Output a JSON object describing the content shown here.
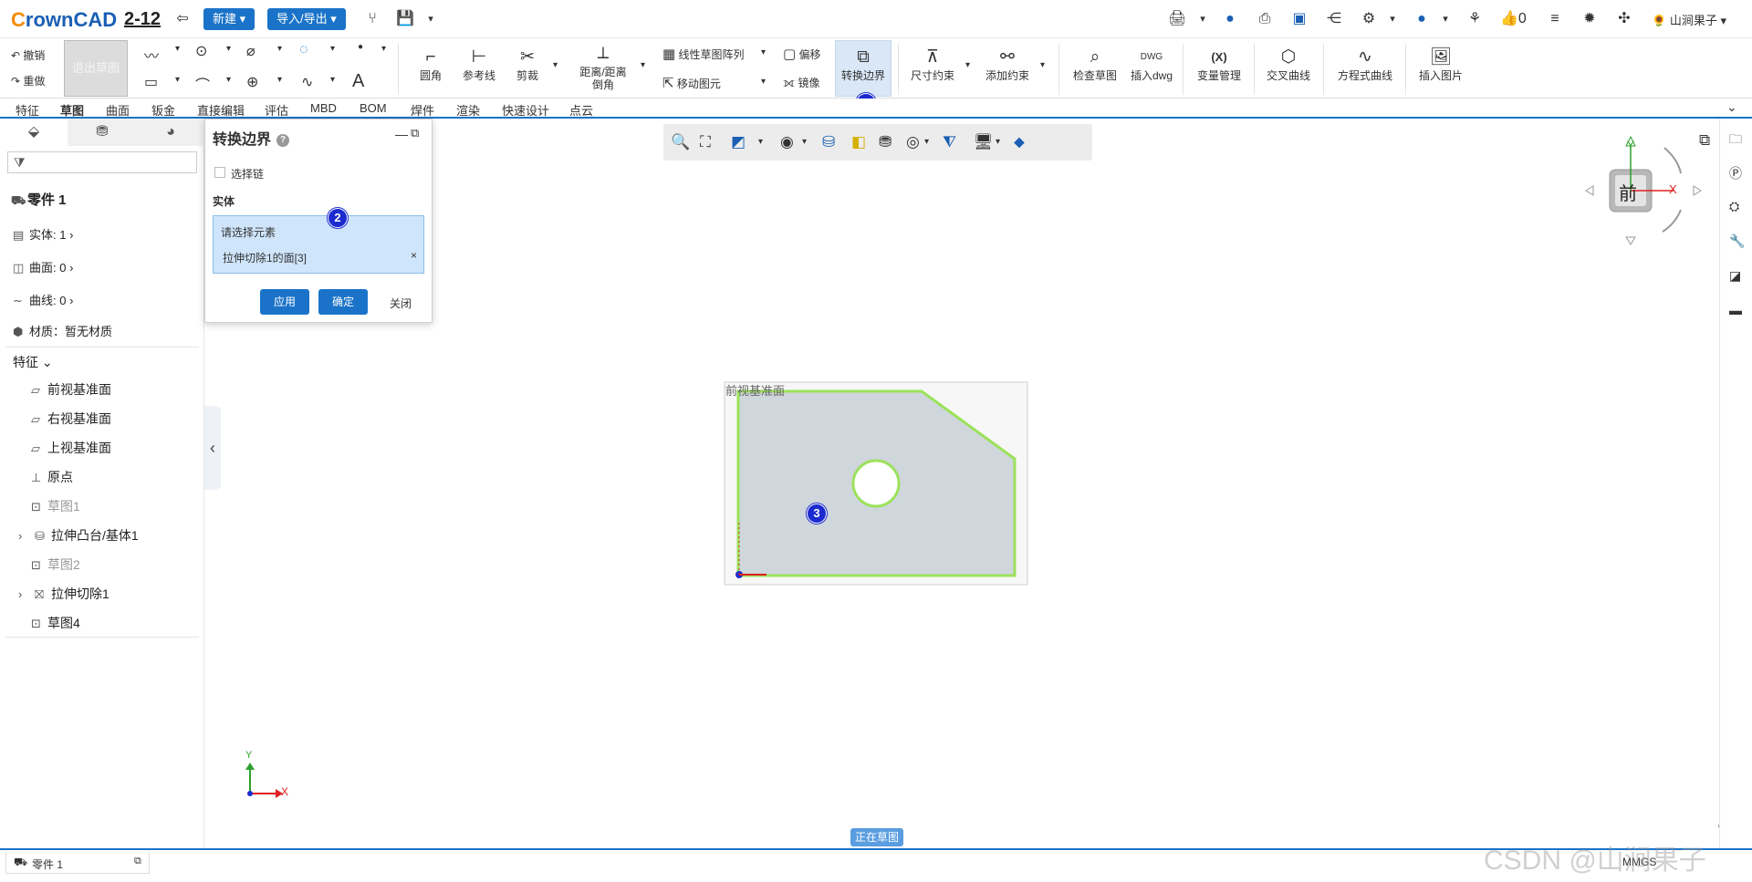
{
  "app": {
    "logo_c": "C",
    "logo_rest": "rownCAD",
    "doc_name": "2-12"
  },
  "topbar": {
    "new_label": "新建",
    "import_export_label": "导入/导出",
    "like_count": "0",
    "user_name": "山涧果子"
  },
  "ribbon": {
    "undo": "撤销",
    "redo": "重做",
    "exit_sketch": "退出草图",
    "fillet": "圆角",
    "ref_line": "参考线",
    "trim": "剪裁",
    "distance_chamfer_1": "距离/距离",
    "distance_chamfer_2": "倒角",
    "linear_pattern": "线性草图阵列",
    "move_entity": "移动图元",
    "offset": "偏移",
    "mirror": "镜像",
    "convert_boundary": "转换边界",
    "dim_constraint": "尺寸约束",
    "add_constraint": "添加约束",
    "check_sketch": "检查草图",
    "insert_dwg": "插入dwg",
    "variable_mgmt": "变量管理",
    "cross_curve": "交叉曲线",
    "equation_curve": "方程式曲线",
    "insert_image": "插入图片",
    "dwg_tag": "DWG",
    "var_tag": "(X)"
  },
  "tabs": [
    "特征",
    "草图",
    "曲面",
    "钣金",
    "直接编辑",
    "评估",
    "MBD",
    "BOM",
    "焊件",
    "渲染",
    "快速设计",
    "点云"
  ],
  "active_tab_index": 1,
  "tree": {
    "part_name": "零件 1",
    "solids": "实体: 1",
    "surfaces": "曲面: 0",
    "curves": "曲线: 0",
    "material": "材质：暂无材质",
    "features_label": "特征",
    "items": [
      {
        "label": "前视基准面",
        "grey": false
      },
      {
        "label": "右视基准面",
        "grey": false
      },
      {
        "label": "上视基准面",
        "grey": false
      },
      {
        "label": "原点",
        "grey": false
      },
      {
        "label": "草图1",
        "grey": true
      },
      {
        "label": "拉伸凸台/基体1",
        "grey": false
      },
      {
        "label": "草图2",
        "grey": true
      },
      {
        "label": "拉伸切除1",
        "grey": false
      },
      {
        "label": "草图4",
        "grey": false
      }
    ]
  },
  "dialog": {
    "title": "转换边界",
    "select_chain": "选择链",
    "entity_label": "实体",
    "prompt": "请选择元素",
    "selected_item": "拉伸切除1的面[3]",
    "apply": "应用",
    "ok": "确定",
    "close": "关闭"
  },
  "markers": [
    "1",
    "2",
    "3"
  ],
  "canvas": {
    "plane_label": "前视基准面",
    "view_cube_label": "前",
    "axis_x": "X",
    "axis_y": "Y",
    "status": "正在草图"
  },
  "bottom": {
    "part_tab": "零件 1",
    "units": "MMGS",
    "watermark": "CSDN @山涧果子"
  },
  "colors": {
    "accent": "#1a73c8",
    "sketch_fill": "#cfd6dc",
    "sketch_edge": "#9be25a",
    "marker": "#1c2bd0"
  }
}
